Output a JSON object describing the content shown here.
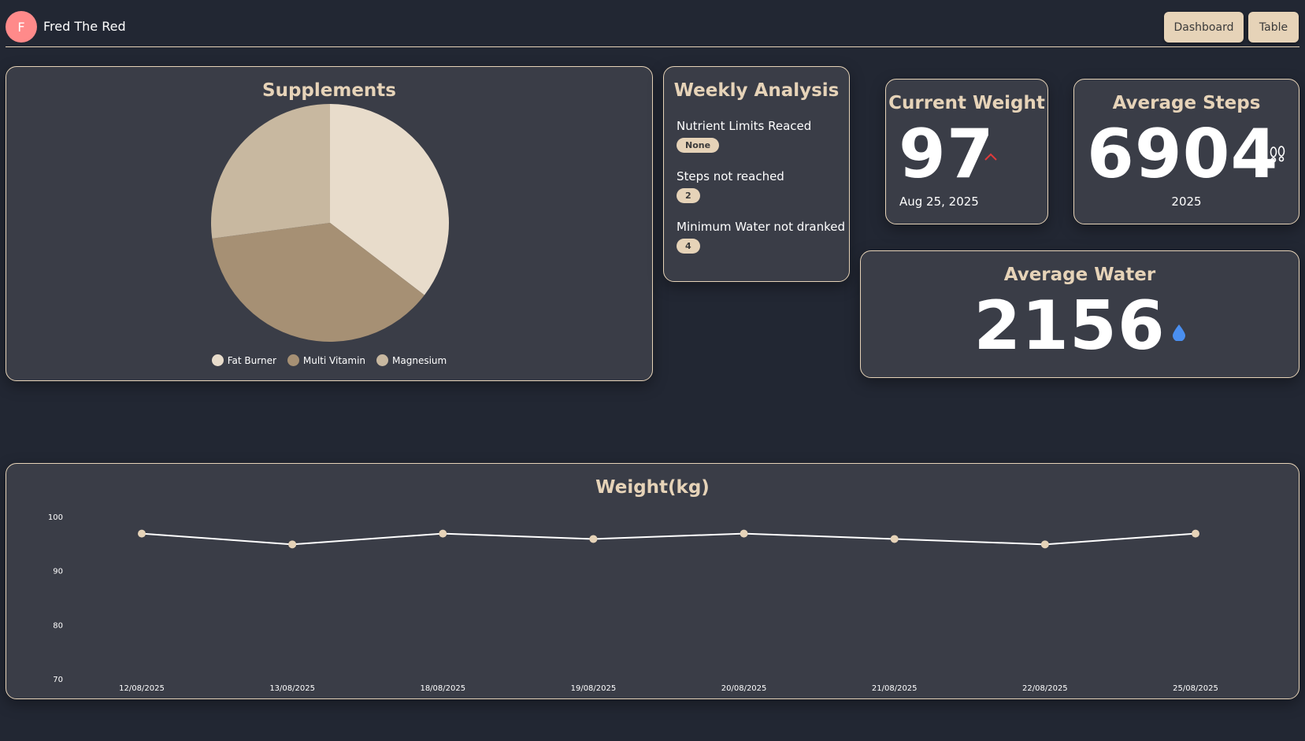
{
  "header": {
    "avatar_initial": "F",
    "user_name": "Fred The Red",
    "nav": {
      "dashboard": "Dashboard",
      "table": "Table"
    }
  },
  "supplements": {
    "title": "Supplements",
    "chart_data": {
      "type": "pie",
      "labels": [
        "Fat Burner",
        "Multi Vitamin",
        "Magnesium"
      ],
      "values": [
        35.4,
        37.5,
        27.1
      ],
      "colors": [
        "#e8dccb",
        "#a69074",
        "#c8b8a0"
      ],
      "legend": "bottom"
    }
  },
  "weekly": {
    "title": "Weekly Analysis",
    "items": [
      {
        "label": "Nutrient Limits Reaced",
        "value": "None"
      },
      {
        "label": "Steps not reached",
        "value": "2"
      },
      {
        "label": "Minimum Water not dranked",
        "value": "4"
      }
    ]
  },
  "current_weight": {
    "title": "Current Weight",
    "value": "97",
    "date": "Aug 25, 2025",
    "trend": "up",
    "trend_color": "#e03a3a"
  },
  "average_steps": {
    "title": "Average Steps",
    "value": "6904",
    "year": "2025"
  },
  "average_water": {
    "title": "Average Water",
    "value": "2156",
    "drop_color": "#4a8ff0"
  },
  "weight_chart": {
    "title": "Weight(kg)",
    "chart_data": {
      "type": "line",
      "categories": [
        "12/08/2025",
        "13/08/2025",
        "18/08/2025",
        "19/08/2025",
        "20/08/2025",
        "21/08/2025",
        "22/08/2025",
        "25/08/2025"
      ],
      "series": [
        {
          "values": [
            97,
            95,
            97,
            96,
            97,
            96,
            95,
            97
          ]
        }
      ],
      "ylim": [
        70,
        100
      ],
      "yticks": [
        100,
        90,
        80,
        70
      ],
      "line_color": "#ffffff",
      "point_color": "#e6d3b8",
      "grid": false
    }
  }
}
